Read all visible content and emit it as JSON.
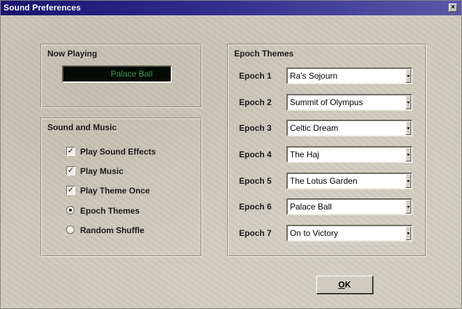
{
  "window": {
    "title": "Sound Preferences",
    "close_glyph": "×"
  },
  "now_playing": {
    "title": "Now Playing",
    "track": "Palace Ball"
  },
  "sound_music": {
    "title": "Sound and Music",
    "options": [
      {
        "type": "checkbox",
        "label": "Play Sound Effects",
        "checked": true
      },
      {
        "type": "checkbox",
        "label": "Play Music",
        "checked": true
      },
      {
        "type": "checkbox",
        "label": "Play Theme Once",
        "checked": true
      },
      {
        "type": "radio",
        "label": "Epoch Themes",
        "checked": true
      },
      {
        "type": "radio",
        "label": "Random Shuffle",
        "checked": false
      }
    ],
    "check_glyph": "✓"
  },
  "epoch_themes": {
    "title": "Epoch Themes",
    "rows": [
      {
        "label": "Epoch 1",
        "value": "Ra's Sojourn"
      },
      {
        "label": "Epoch 2",
        "value": "Summit of Olympus"
      },
      {
        "label": "Epoch 3",
        "value": "Celtic Dream"
      },
      {
        "label": "Epoch 4",
        "value": "The Haj"
      },
      {
        "label": "Epoch 5",
        "value": "The Lotus Garden"
      },
      {
        "label": "Epoch 6",
        "value": "Palace Ball"
      },
      {
        "label": "Epoch 7",
        "value": "On to Victory"
      }
    ]
  },
  "ok_button": {
    "mnemonic": "O",
    "rest": "K"
  },
  "colors": {
    "titlebar": "#1a1270",
    "display_bg": "#050a05",
    "display_text": "#3e9a4c",
    "dialog_bg": "#cfcbbd"
  },
  "icons": {
    "close": "close-icon",
    "combo_arrow": "chevron-down-icon"
  }
}
